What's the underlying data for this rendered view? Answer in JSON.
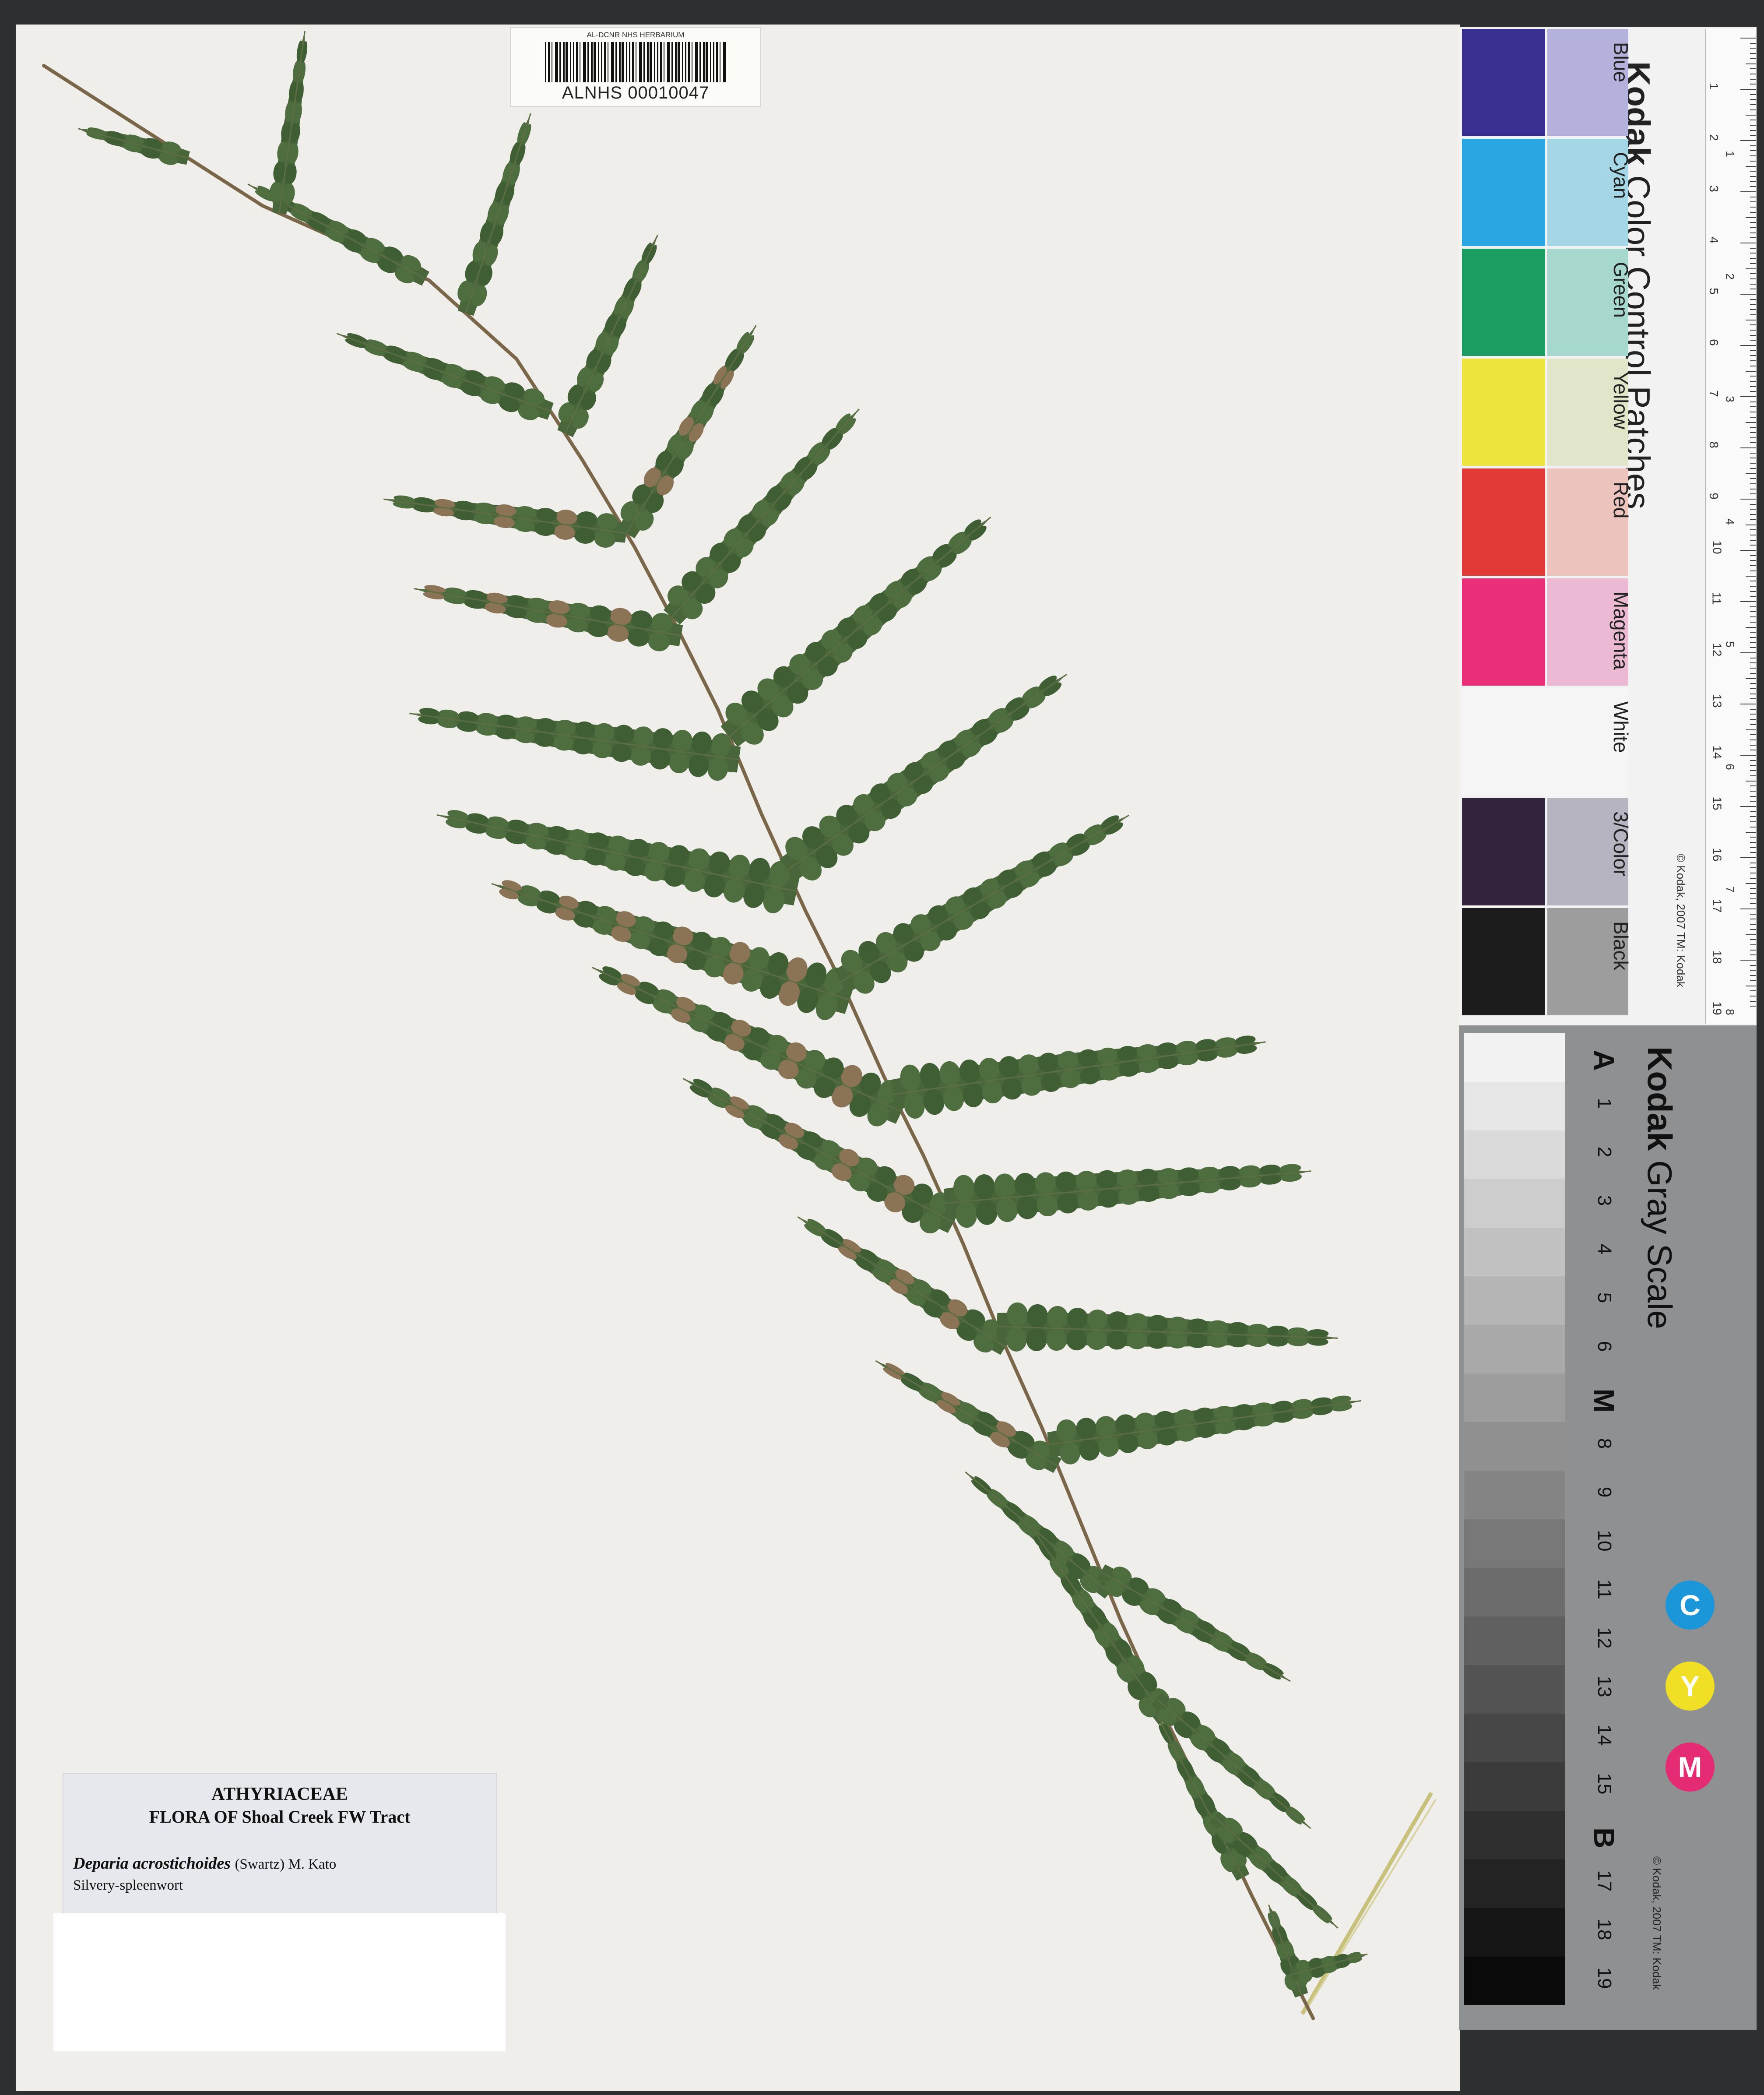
{
  "barcode": {
    "header": "AL-DCNR NHS HERBARIUM",
    "number": "ALNHS 00010047"
  },
  "label": {
    "family": "ATHYRIACEAE",
    "flora": "FLORA OF Shoal Creek FW Tract",
    "species": "Deparia acrostichoides",
    "authority": "(Swartz) M. Kato",
    "common_name": "Silvery-spleenwort"
  },
  "color_card": {
    "brand": "Kodak",
    "title": "Color Control Patches",
    "patch_names": [
      "Blue",
      "Cyan",
      "Green",
      "Yellow",
      "Red",
      "Magenta",
      "White",
      "3/Color",
      "Black"
    ],
    "colors_dark": [
      "#3a3092",
      "#2aa7e2",
      "#1c9e62",
      "#eee43e",
      "#e23a36",
      "#eb2e78",
      "#f5f5f5",
      "#33243e",
      "#1c1c1c"
    ],
    "colors_light": [
      "#b4b2dc",
      "#a4d6e6",
      "#a6d8cd",
      "#e1e6c9",
      "#edc4bd",
      "#ebbad2",
      "#f5f5f5",
      "#b6b4c0",
      "#9d9d9d"
    ],
    "copyright": "© Kodak, 2007 TM: Kodak",
    "ruler_cm": [
      "1",
      "2",
      "3",
      "4",
      "5",
      "6",
      "7",
      "8",
      "9",
      "10",
      "11",
      "12",
      "13",
      "14",
      "15",
      "16",
      "17",
      "18",
      "19"
    ],
    "ruler_in": [
      "1",
      "2",
      "3",
      "4",
      "5",
      "6",
      "7",
      "8"
    ]
  },
  "gray_card": {
    "brand": "Kodak",
    "title": "Gray Scale",
    "steps": [
      "A",
      "1",
      "2",
      "3",
      "4",
      "5",
      "6",
      "M",
      "8",
      "9",
      "10",
      "11",
      "12",
      "13",
      "14",
      "15",
      "B",
      "17",
      "18",
      "19"
    ],
    "cmy": [
      "C",
      "Y",
      "M"
    ],
    "cmy_colors": [
      "#1b96d9",
      "#f1df25",
      "#e52b72"
    ],
    "copyright": "© Kodak, 2007 TM: Kodak"
  }
}
